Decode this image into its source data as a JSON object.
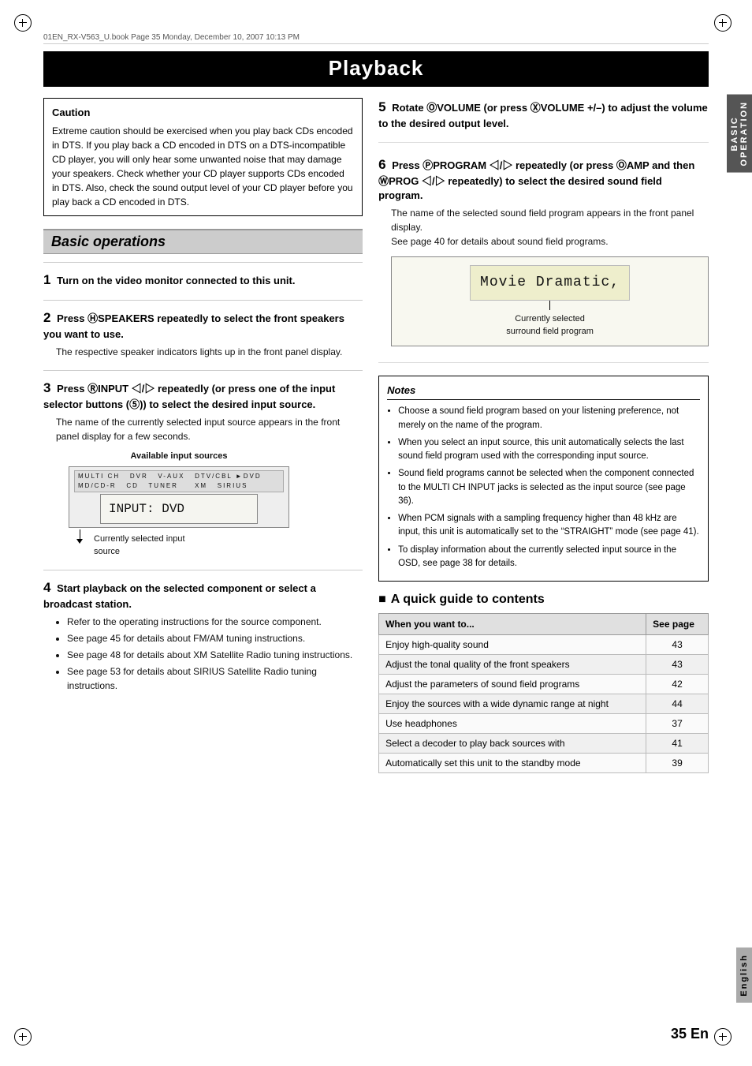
{
  "page": {
    "title": "Playback",
    "page_number": "35 En",
    "header_text": "01EN_RX-V563_U.book  Page 35  Monday, December 10, 2007  10:13 PM"
  },
  "sidebar": {
    "top_label": "BASIC\nOPERATION",
    "bottom_label": "English"
  },
  "caution": {
    "title": "Caution",
    "text": "Extreme caution should be exercised when you play back CDs encoded in DTS. If you play back a CD encoded in DTS on a DTS-incompatible CD player, you will only hear some unwanted noise that may damage your speakers. Check whether your CD player supports CDs encoded in DTS. Also, check the sound output level of your CD player before you play back a CD encoded in DTS."
  },
  "section": {
    "title": "Basic operations"
  },
  "steps_left": [
    {
      "number": "1",
      "header": "Turn on the video monitor connected to this unit.",
      "body": ""
    },
    {
      "number": "2",
      "header": "Press ⓂSPEAKERS repeatedly to select the front speakers you want to use.",
      "body": "The respective speaker indicators lights up in the front panel display."
    },
    {
      "number": "3",
      "header": "Press ⓇINPUT ◁/▷ repeatedly (or press one of the input selector buttons (⑤)) to select the desired input source.",
      "body": "The name of the currently selected input source appears in the front panel display for a few seconds.",
      "diagram": {
        "label": "Available input sources",
        "display_row": "MULTI CH    DVR   V-AUX   DTV/CBL ► DVD   MD/CD-R   CD   TUNER         XM    SIRIUS",
        "display_text": "INPUT: DVD",
        "caption": "Currently selected input\nsource"
      }
    },
    {
      "number": "4",
      "header": "Start playback on the selected component or select a broadcast station.",
      "body": "",
      "bullets": [
        "Refer to the operating instructions for the source component.",
        "See page 45 for details about FM/AM tuning instructions.",
        "See page 48 for details about XM Satellite Radio tuning instructions.",
        "See page 53 for details about SIRIUS Satellite Radio tuning instructions."
      ]
    }
  ],
  "steps_right": [
    {
      "number": "5",
      "header": "Rotate ⓄVOLUME (or press ⓍVOLUME +/–) to adjust the volume to the desired output level."
    },
    {
      "number": "6",
      "header": "Press ⓅPROGRAM ◁/▷ repeatedly (or press ⓄAMP and then ⓌPROG ◁/▷ repeatedly) to select the desired sound field program.",
      "body": "The name of the selected sound field program appears in the front panel display.\nSee page 40 for details about sound field programs.",
      "display": {
        "text": "Movie Dramatic,",
        "caption_line1": "Currently selected",
        "caption_line2": "surround field program"
      }
    }
  ],
  "notes": {
    "title": "Notes",
    "items": [
      "Choose a sound field program based on your listening preference, not merely on the name of the program.",
      "When you select an input source, this unit automatically selects the last sound field program used with the corresponding input source.",
      "Sound field programs cannot be selected when the component connected to the MULTI CH INPUT jacks is selected as the input source (see page 36).",
      "When PCM signals with a sampling frequency higher than 48 kHz are input, this unit is automatically set to the “STRAIGHT” mode (see page 41).",
      "To display information about the currently selected input source in the OSD, see page 38 for details."
    ]
  },
  "quick_guide": {
    "title": "A quick guide to contents",
    "table": {
      "col1": "When you want to...",
      "col2": "See page",
      "rows": [
        {
          "action": "Enjoy high-quality sound",
          "page": "43"
        },
        {
          "action": "Adjust the tonal quality of the front speakers",
          "page": "43"
        },
        {
          "action": "Adjust the parameters of sound field programs",
          "page": "42"
        },
        {
          "action": "Enjoy the sources with a wide dynamic range at night",
          "page": "44"
        },
        {
          "action": "Use headphones",
          "page": "37"
        },
        {
          "action": "Select a decoder to play back sources with",
          "page": "41"
        },
        {
          "action": "Automatically set this unit to the standby mode",
          "page": "39"
        }
      ]
    }
  }
}
